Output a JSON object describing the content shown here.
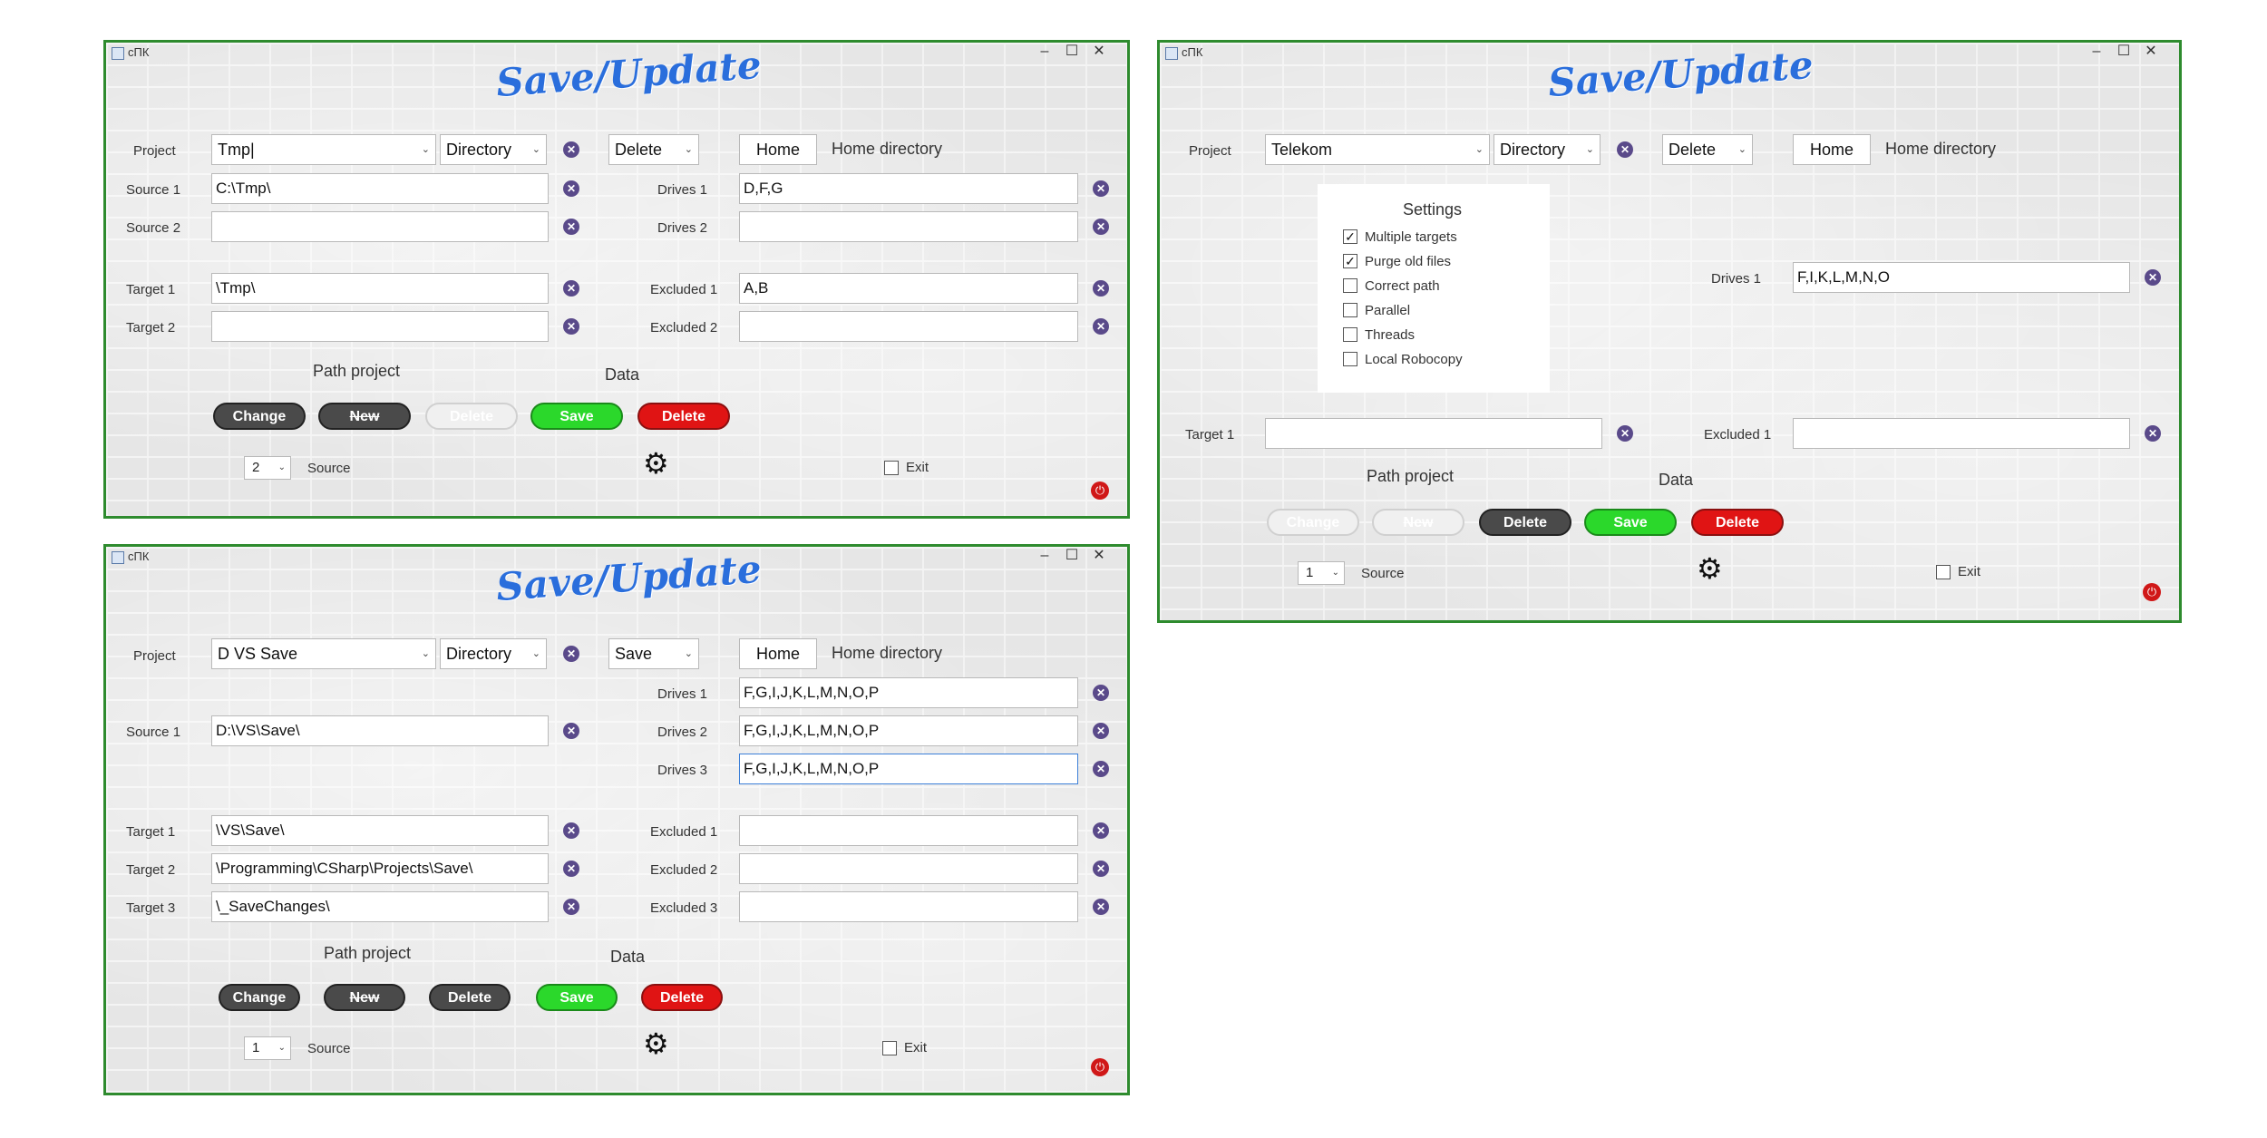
{
  "app_title": "cПК",
  "logo": {
    "a": "Save",
    "sep": "/",
    "b": "Update"
  },
  "titlebar": {
    "min": "–",
    "max": "☐",
    "close": "✕"
  },
  "common": {
    "project": "Project",
    "directory": "Directory",
    "home": "Home",
    "home_dir": "Home directory",
    "path_project": "Path project",
    "data": "Data",
    "source": "Source",
    "exit": "Exit",
    "btn_change": "Change",
    "btn_new": "New",
    "btn_delete": "Delete",
    "btn_save": "Save"
  },
  "win1": {
    "project_value": "Tmp|",
    "action": "Delete",
    "source1_label": "Source 1",
    "source1": "C:\\Tmp\\",
    "source2_label": "Source 2",
    "source2": "",
    "target1_label": "Target 1",
    "target1": "\\Tmp\\",
    "target2_label": "Target 2",
    "target2": "",
    "drives1_label": "Drives 1",
    "drives1": "D,F,G",
    "drives2_label": "Drives 2",
    "drives2": "",
    "excluded1_label": "Excluded 1",
    "excluded1": "A,B",
    "excluded2_label": "Excluded 2",
    "excluded2": "",
    "spin": "2"
  },
  "win2": {
    "project_value": "D VS Save",
    "action": "Save",
    "drives1_label": "Drives 1",
    "drives1": "F,G,I,J,K,L,M,N,O,P",
    "drives2_label": "Drives 2",
    "drives2": "F,G,I,J,K,L,M,N,O,P",
    "drives3_label": "Drives 3",
    "drives3": "F,G,I,J,K,L,M,N,O,P",
    "source1_label": "Source 1",
    "source1": "D:\\VS\\Save\\",
    "target1_label": "Target 1",
    "target1": "\\VS\\Save\\",
    "target2_label": "Target 2",
    "target2": "\\Programming\\CSharp\\Projects\\Save\\",
    "target3_label": "Target 3",
    "target3": "\\_SaveChanges\\",
    "excluded1_label": "Excluded 1",
    "excluded1": "",
    "excluded2_label": "Excluded 2",
    "excluded2": "",
    "excluded3_label": "Excluded 3",
    "excluded3": "",
    "spin": "1"
  },
  "win3": {
    "project_value": "Telekom",
    "action": "Delete",
    "settings_title": "Settings",
    "settings": [
      {
        "label": "Multiple targets",
        "checked": "✓"
      },
      {
        "label": "Purge old files",
        "checked": "✓"
      },
      {
        "label": "Correct path",
        "checked": ""
      },
      {
        "label": "Parallel",
        "checked": ""
      },
      {
        "label": "Threads",
        "checked": ""
      },
      {
        "label": "Local Robocopy",
        "checked": ""
      }
    ],
    "drives1_label": "Drives 1",
    "drives1": "F,I,K,L,M,N,O",
    "target1_label": "Target 1",
    "target1": "",
    "excluded1_label": "Excluded 1",
    "excluded1": "",
    "spin": "1"
  },
  "colors": {
    "border": "#2e8b2e",
    "logo": "#2a6edc",
    "save": "#2bd82b",
    "delete": "#e01414",
    "clear": "#5a4a8a"
  }
}
